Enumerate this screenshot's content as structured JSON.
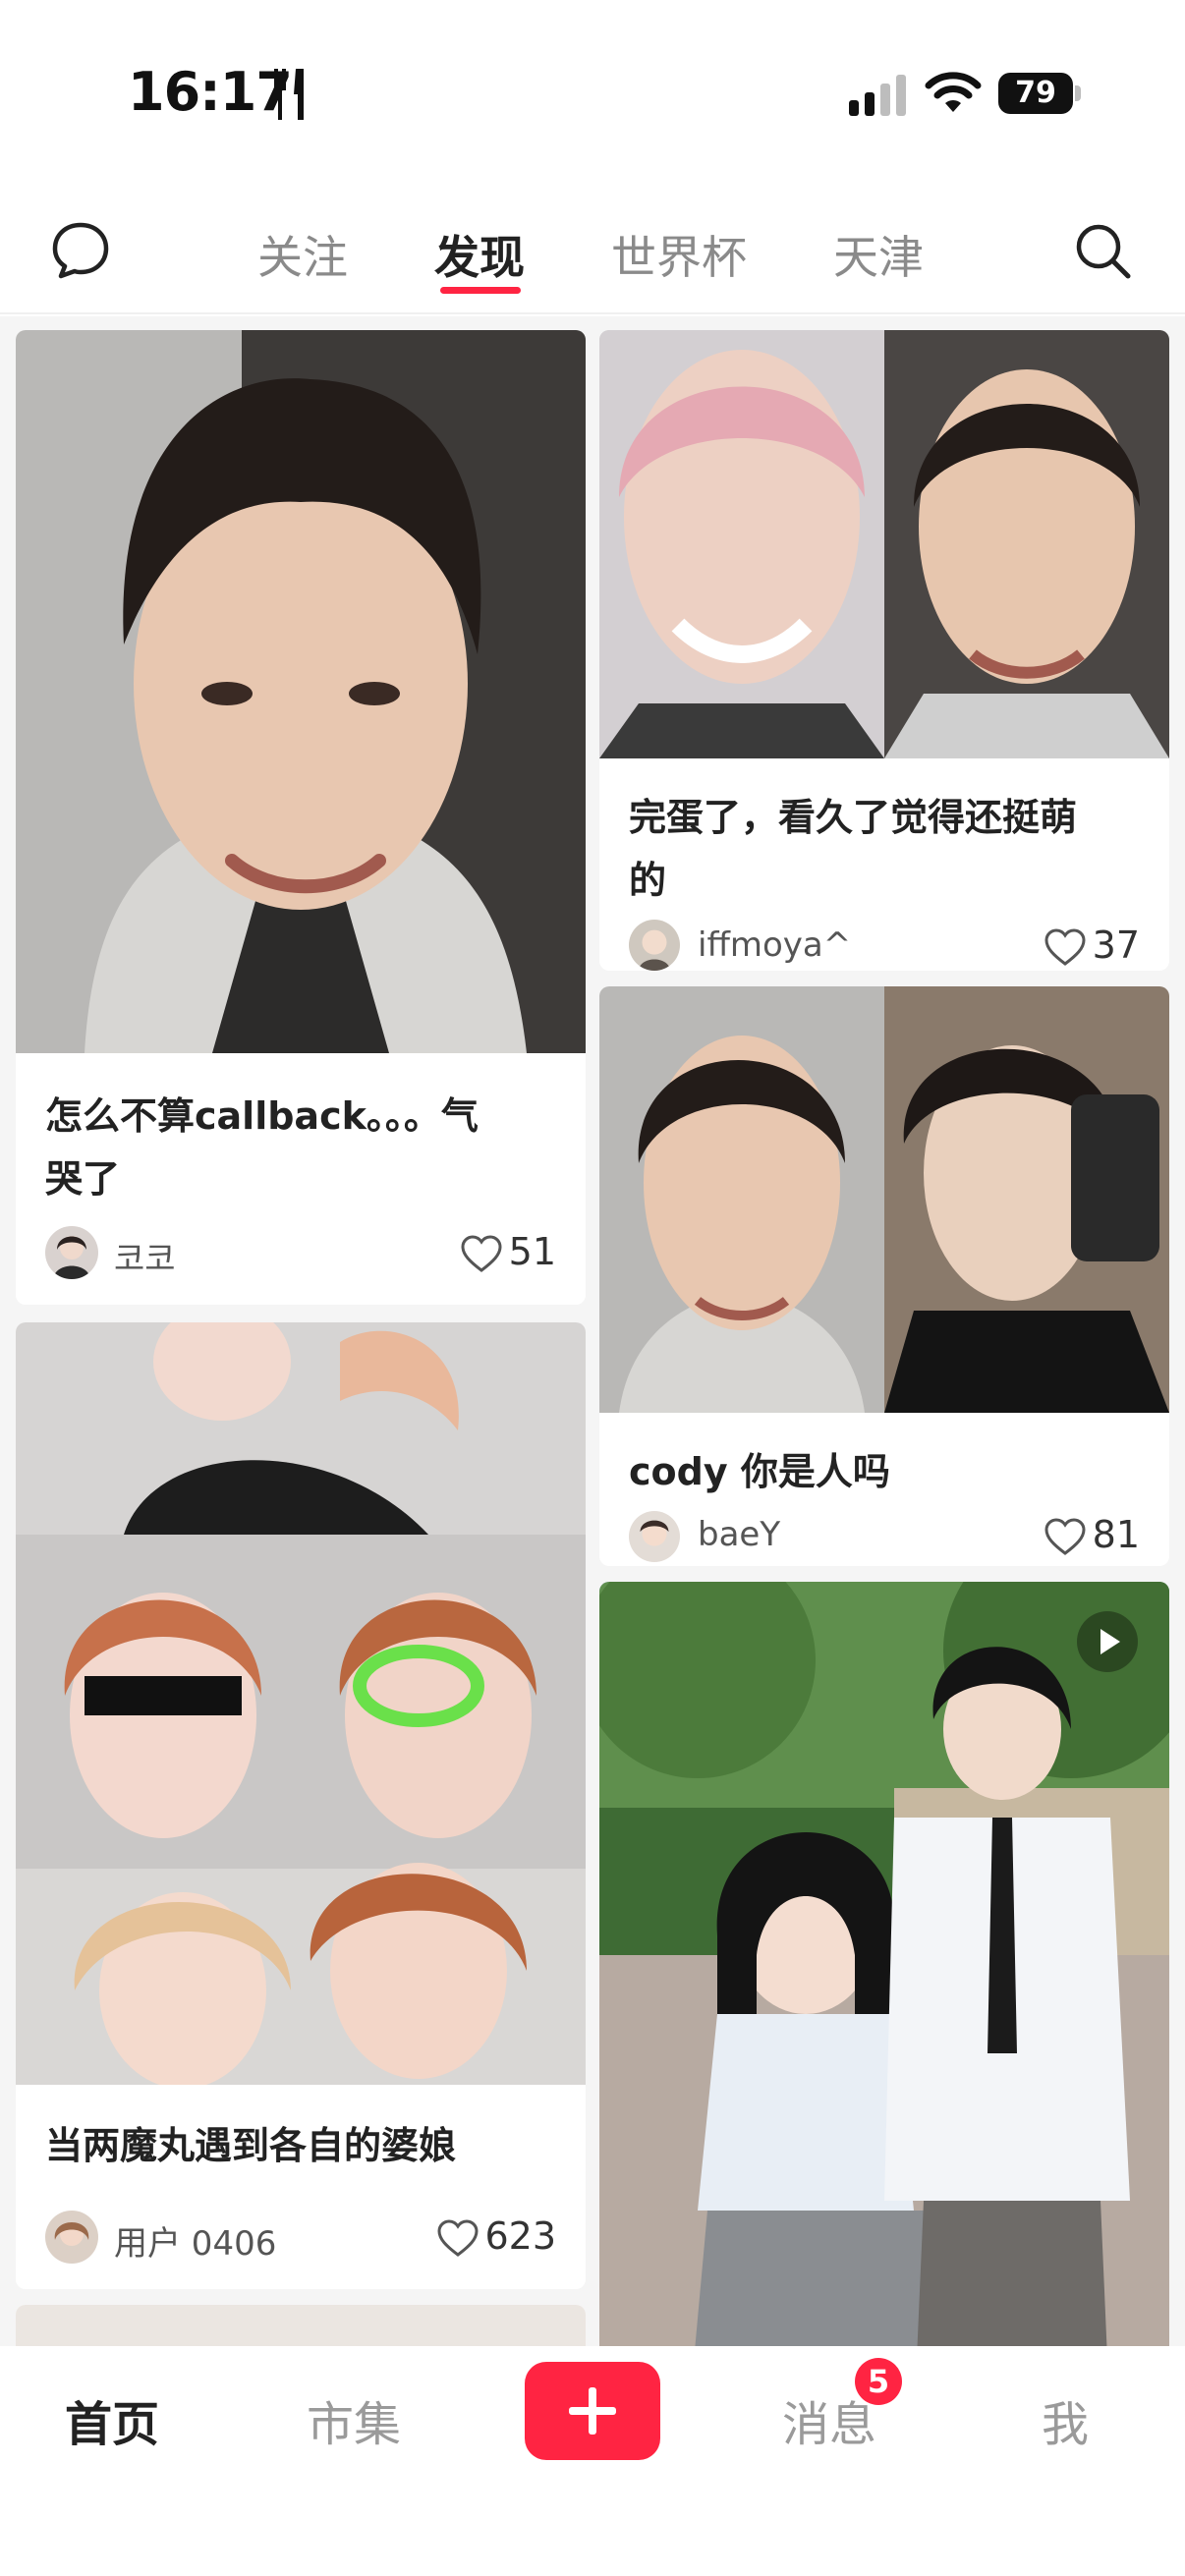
{
  "status_bar": {
    "time": "16:17",
    "battery": "79"
  },
  "top_nav": {
    "tabs": [
      {
        "label": "关注"
      },
      {
        "label": "发现"
      },
      {
        "label": "世界杯"
      },
      {
        "label": "天津"
      }
    ],
    "active_tab": "发现"
  },
  "feed": {
    "cards": [
      {
        "title": "怎么不算callback。。。气哭了",
        "title_line1": "怎么不算callback。。。气",
        "title_line2": "哭了",
        "author": "코코",
        "likes": "51"
      },
      {
        "title": "完蛋了，看久了觉得还挺萌的",
        "title_line1": "完蛋了，看久了觉得还挺萌",
        "title_line2": "的",
        "author": "iffmoya^",
        "likes": "37"
      },
      {
        "title": "cody 你是人吗",
        "author": "baeY",
        "likes": "81"
      },
      {
        "title": "当两魔丸遇到各自的婆娘",
        "author": "用户 0406",
        "likes": "623"
      },
      {
        "title": "",
        "author": "",
        "likes": "",
        "is_video": true
      }
    ]
  },
  "bottom_bar": {
    "items": [
      {
        "label": "首页"
      },
      {
        "label": "市集"
      },
      {
        "label": "消息"
      },
      {
        "label": "我"
      }
    ],
    "messages_badge": "5"
  },
  "colors": {
    "accent": "#ff2442",
    "text_primary": "#222222",
    "text_secondary": "#8a8a8a",
    "feed_background": "#f5f5f5"
  },
  "icons": [
    "message-bubble-icon",
    "search-icon",
    "heart-icon",
    "play-icon",
    "plus-icon",
    "fork-knife-icon",
    "cellular-signal-icon",
    "wifi-icon",
    "battery-icon"
  ]
}
